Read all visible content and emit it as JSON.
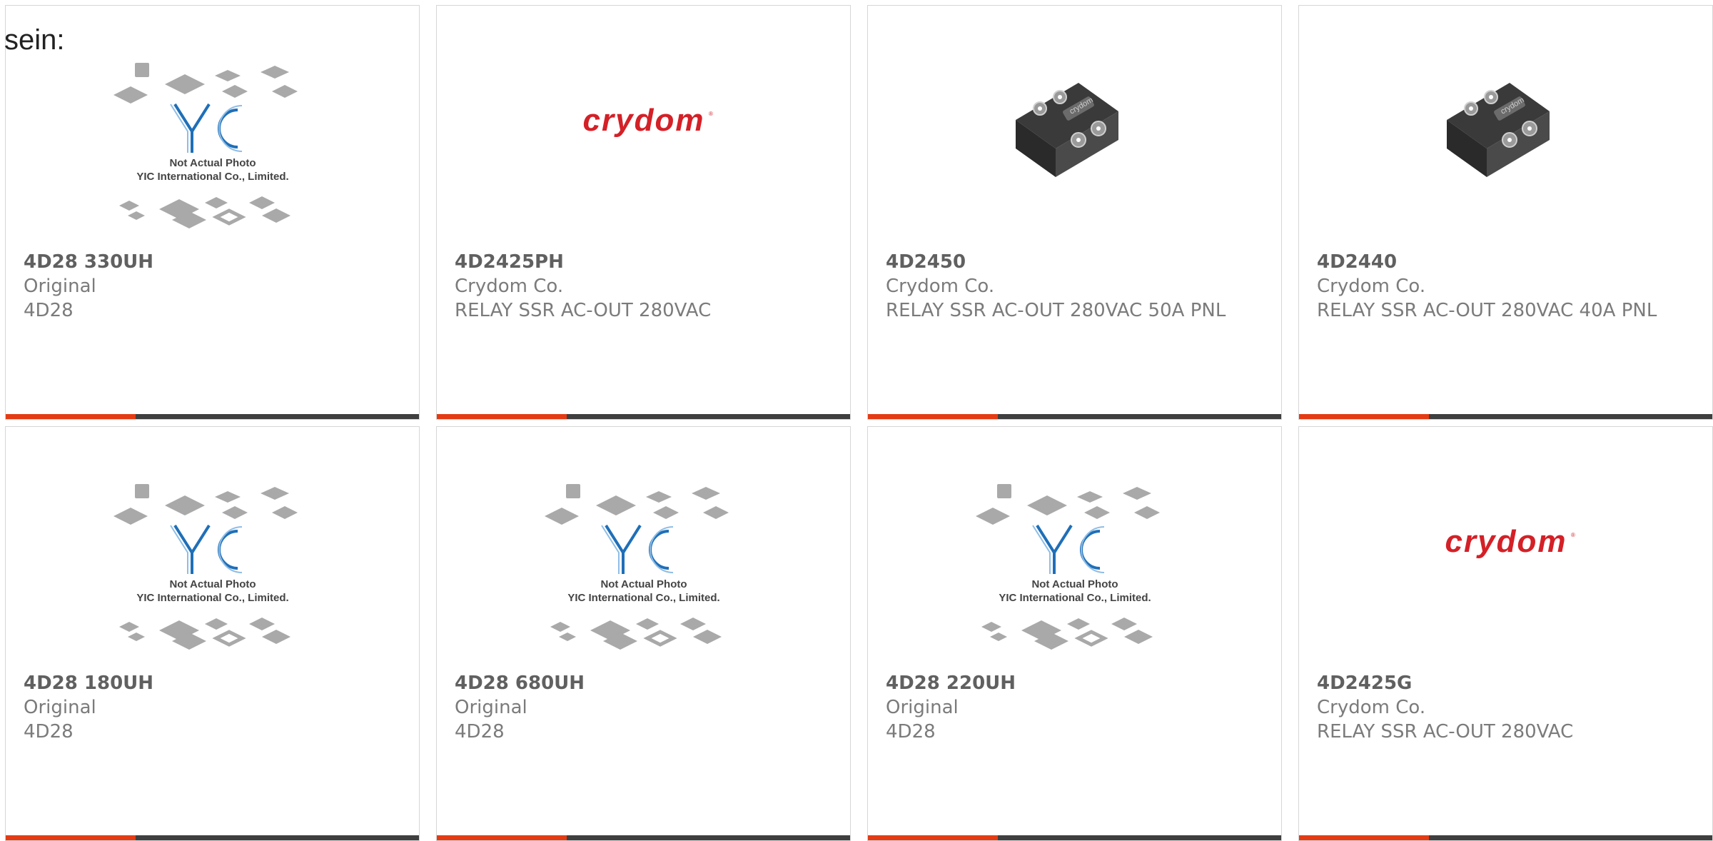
{
  "intro_text": "sein:",
  "colors": {
    "accent": "#e43b14",
    "bar": "#3f3f3f",
    "brand_crydom": "#d42027",
    "brand_yic": "#1f6fb8"
  },
  "products": [
    {
      "part": "4D28 330UH",
      "maker": "Original",
      "desc": "4D28",
      "image": "yic-not-actual-photo",
      "placeholder": {
        "line1": "Not Actual Photo",
        "line2": "YIC International Co., Limited."
      }
    },
    {
      "part": "4D2425PH",
      "maker": "Crydom Co.",
      "desc": "RELAY SSR AC-OUT 280VAC",
      "image": "crydom-logo",
      "logo_text": "crydom"
    },
    {
      "part": "4D2450",
      "maker": "Crydom Co.",
      "desc": "RELAY SSR AC-OUT 280VAC 50A PNL",
      "image": "solid-state-relay-photo"
    },
    {
      "part": "4D2440",
      "maker": "Crydom Co.",
      "desc": "RELAY SSR AC-OUT 280VAC 40A PNL",
      "image": "solid-state-relay-photo"
    },
    {
      "part": "4D28 180UH",
      "maker": "Original",
      "desc": "4D28",
      "image": "yic-not-actual-photo",
      "placeholder": {
        "line1": "Not Actual Photo",
        "line2": "YIC International Co., Limited."
      }
    },
    {
      "part": "4D28 680UH",
      "maker": "Original",
      "desc": "4D28",
      "image": "yic-not-actual-photo",
      "placeholder": {
        "line1": "Not Actual Photo",
        "line2": "YIC International Co., Limited."
      }
    },
    {
      "part": "4D28 220UH",
      "maker": "Original",
      "desc": "4D28",
      "image": "yic-not-actual-photo",
      "placeholder": {
        "line1": "Not Actual Photo",
        "line2": "YIC International Co., Limited."
      }
    },
    {
      "part": "4D2425G",
      "maker": "Crydom Co.",
      "desc": "RELAY SSR AC-OUT 280VAC",
      "image": "crydom-logo",
      "logo_text": "crydom"
    }
  ]
}
